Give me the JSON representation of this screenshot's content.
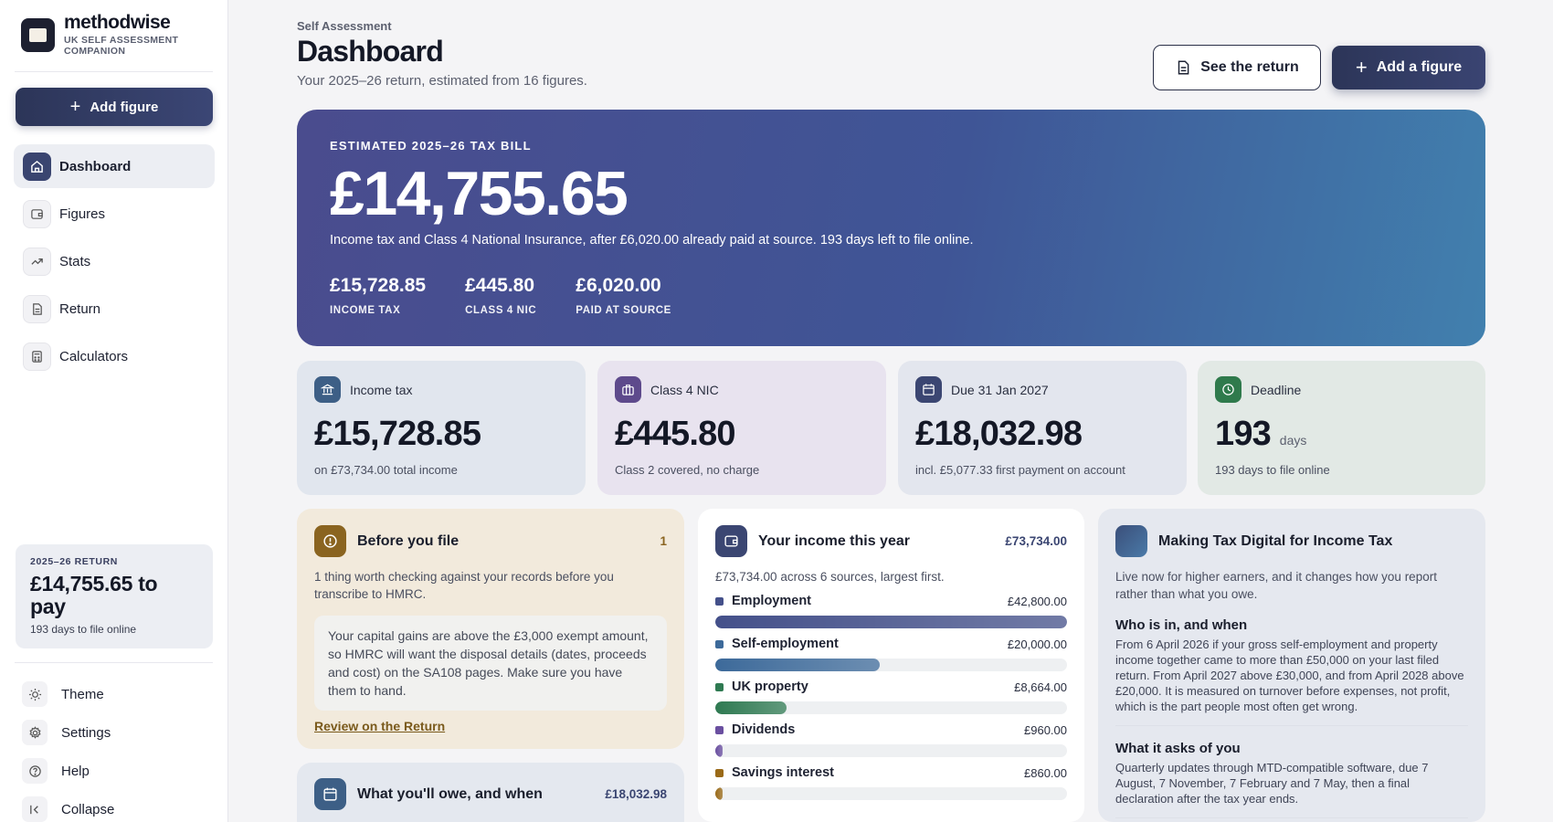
{
  "brand": {
    "name": "methodwise",
    "subtitle": "UK SELF ASSESSMENT COMPANION"
  },
  "sidebar": {
    "add_label": "Add figure",
    "nav": [
      {
        "label": "Dashboard",
        "icon": "home-icon",
        "active": true
      },
      {
        "label": "Figures",
        "icon": "wallet-icon"
      },
      {
        "label": "Stats",
        "icon": "trending-up-icon"
      },
      {
        "label": "Return",
        "icon": "document-icon"
      },
      {
        "label": "Calculators",
        "icon": "calculator-icon"
      }
    ],
    "return_card": {
      "label": "2025–26 RETURN",
      "amount": "£14,755.65 to pay",
      "days": "193 days to file online"
    },
    "bottom": [
      {
        "label": "Theme",
        "icon": "sun-icon"
      },
      {
        "label": "Settings",
        "icon": "gear-icon"
      },
      {
        "label": "Help",
        "icon": "help-icon"
      },
      {
        "label": "Collapse",
        "icon": "collapse-icon"
      }
    ]
  },
  "header": {
    "crumb": "Self Assessment",
    "title": "Dashboard",
    "subtitle": "Your 2025–26 return, estimated from 16 figures.",
    "see_return": "See the return",
    "add_figure": "Add a figure"
  },
  "hero": {
    "label": "ESTIMATED 2025–26 TAX BILL",
    "amount": "£14,755.65",
    "sub": "Income tax and Class 4 National Insurance, after £6,020.00 already paid at source. 193 days left to file online.",
    "stats": [
      {
        "value": "£15,728.85",
        "label": "INCOME TAX"
      },
      {
        "value": "£445.80",
        "label": "CLASS 4 NIC"
      },
      {
        "value": "£6,020.00",
        "label": "PAID AT SOURCE"
      }
    ]
  },
  "kpis": [
    {
      "title": "Income tax",
      "value": "£15,728.85",
      "unit": "",
      "sub": "on £73,734.00 total income",
      "bg": "#e1e6ee",
      "icon_bg": "#3d5f86",
      "icon": "bank-icon"
    },
    {
      "title": "Class 4 NIC",
      "value": "£445.80",
      "unit": "",
      "sub": "Class 2 covered, no charge",
      "bg": "#e8e3ef",
      "icon_bg": "#5e4a8c",
      "icon": "briefcase-icon"
    },
    {
      "title": "Due 31 Jan 2027",
      "value": "£18,032.98",
      "unit": "",
      "sub": "incl. £5,077.33 first payment on account",
      "bg": "#e3e6ee",
      "icon_bg": "#3b4672",
      "icon": "calendar-icon"
    },
    {
      "title": "Deadline",
      "value": "193",
      "unit": "days",
      "sub": "193 days to file online",
      "bg": "#e2e9e5",
      "icon_bg": "#2f7a4c",
      "icon": "clock-icon"
    }
  ],
  "before_file": {
    "title": "Before you file",
    "count": "1",
    "desc": "1 thing worth checking against your records before you transcribe to HMRC.",
    "note": "Your capital gains are above the £3,000 exempt amount, so HMRC will want the disposal details (dates, proceeds and cost) on the SA108 pages. Make sure you have them to hand.",
    "link": "Review on the Return"
  },
  "income": {
    "title": "Your income this year",
    "total": "£73,734.00",
    "desc": "£73,734.00 across 6 sources, largest first.",
    "rows": [
      {
        "name": "Employment",
        "amount": "£42,800.00",
        "fraction": 1.0,
        "color": "#44508a"
      },
      {
        "name": "Self-employment",
        "amount": "£20,000.00",
        "fraction": 0.467,
        "color": "#3d6a9a"
      },
      {
        "name": "UK property",
        "amount": "£8,664.00",
        "fraction": 0.202,
        "color": "#2f7a52"
      },
      {
        "name": "Dividends",
        "amount": "£960.00",
        "fraction": 0.022,
        "color": "#6a4fa0"
      },
      {
        "name": "Savings interest",
        "amount": "£860.00",
        "fraction": 0.02,
        "color": "#9a6a18"
      }
    ]
  },
  "mtd": {
    "title": "Making Tax Digital for Income Tax",
    "desc": "Live now for higher earners, and it changes how you report rather than what you owe.",
    "sections": [
      {
        "heading": "Who is in, and when",
        "body": "From 6 April 2026 if your gross self-employment and property income together came to more than £50,000 on your last filed return. From April 2027 above £30,000, and from April 2028 above £20,000. It is measured on turnover before expenses, not profit, which is the part people most often get wrong."
      },
      {
        "heading": "What it asks of you",
        "body": "Quarterly updates through MTD-compatible software, due 7 August, 7 November, 7 February and 7 May, then a final declaration after the tax year ends."
      }
    ]
  },
  "owe": {
    "title": "What you'll owe, and when",
    "amount": "£18,032.98"
  }
}
